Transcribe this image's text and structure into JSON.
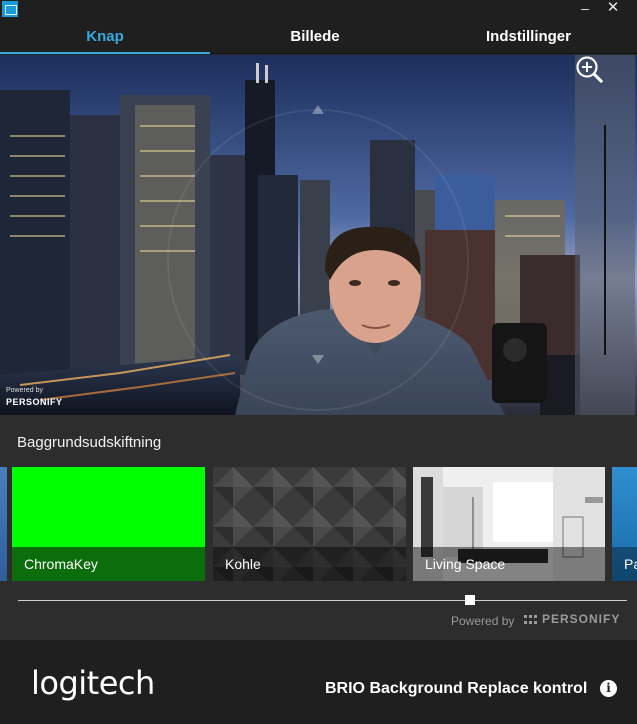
{
  "window": {
    "minimize_glyph": "–",
    "close_glyph": "✕",
    "app_icon": "logitech-camera-icon"
  },
  "tabs": [
    {
      "label": "Knap",
      "active": true
    },
    {
      "label": "Billede",
      "active": false
    },
    {
      "label": "Indstillinger",
      "active": false
    }
  ],
  "preview": {
    "powered_by_small": "Powered by",
    "personify_small": "PERSONIFY",
    "zoom_in_icon": "zoom-in-icon",
    "zoom_out_icon": "zoom-out-icon"
  },
  "background_section": {
    "title": "Baggrundsudskiftning",
    "thumbnails": [
      {
        "label": "ChromaKey",
        "color": "#00ff00"
      },
      {
        "label": "Kohle",
        "color": "#3a3a3a"
      },
      {
        "label": "Living Space",
        "color": "#ececec"
      },
      {
        "label": "Pa",
        "color": "#1a6aa8"
      }
    ],
    "slider_value": 0.75,
    "powered_by": "Powered by",
    "personify": "PERSONIFY"
  },
  "footer": {
    "logo": "logitech",
    "product_title": "BRIO Background Replace kontrol",
    "info_icon": "info-icon"
  },
  "colors": {
    "accent": "#36a9e1",
    "background": "#2b2b2b",
    "footer": "#1f1f1f"
  }
}
